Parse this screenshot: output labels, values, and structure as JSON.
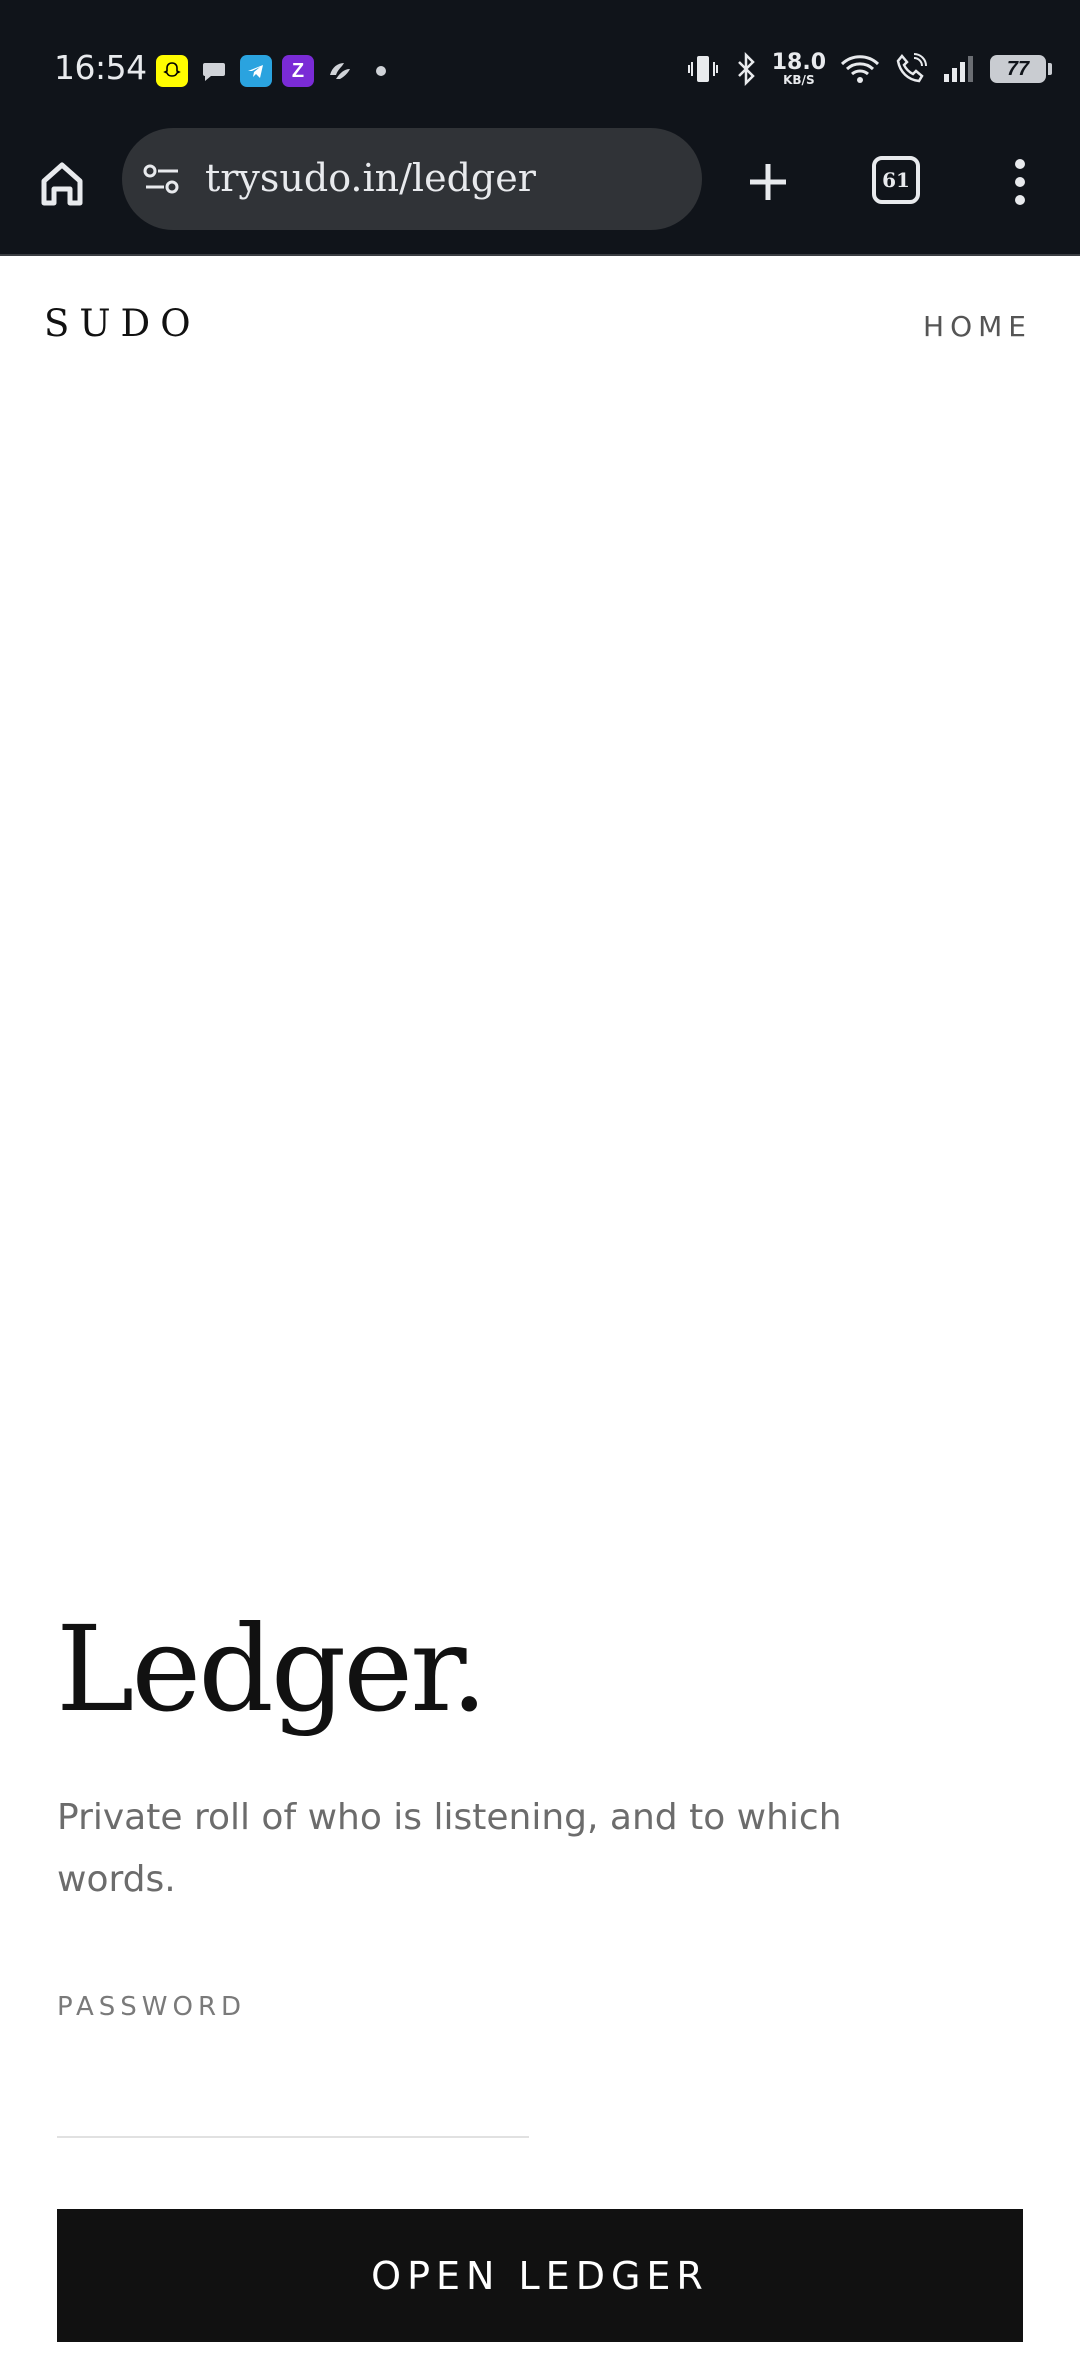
{
  "status_bar": {
    "time": "16:54",
    "notification_icons": [
      "snapchat-icon",
      "chat-bubble-icon",
      "telegram-icon",
      "zepto-icon",
      "tea-app-icon",
      "dot-icon"
    ],
    "net_speed_value": "18.0",
    "net_speed_unit": "KB/S",
    "battery": "77",
    "system_icons": [
      "vibrate-icon",
      "bluetooth-icon",
      "wifi-icon",
      "wifi-call-icon",
      "signal-icon"
    ]
  },
  "browser": {
    "url": "trysudo.in/ledger",
    "tab_count": "61"
  },
  "site": {
    "logo": "SUDO",
    "nav_home": "HOME"
  },
  "ledger": {
    "title": "Ledger.",
    "subtitle": "Private roll of who is listening, and to which words.",
    "password_label": "PASSWORD",
    "password_value": "",
    "submit_label": "OPEN LEDGER"
  },
  "colors": {
    "status_bar_bg": "#10141a",
    "url_pill_bg": "#303337",
    "button_bg": "#111111",
    "text_muted": "#6c6c6c"
  }
}
